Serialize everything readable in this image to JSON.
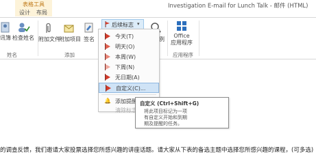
{
  "titlebar": {
    "context_group": "表格工具",
    "tabs": [
      "设计",
      "布局"
    ],
    "window_title": "Investigation E-mail for Lunch Talk - 邮件 (HTML)"
  },
  "ribbon": {
    "buttons": {
      "address_book": "讯簿",
      "check_names": "检查姓名",
      "attach_file": "附加文件",
      "attach_item": "附加项目",
      "signature": "签名",
      "zoom_partial": "比例",
      "office_apps_line1": "Office",
      "office_apps_line2": "应用程序"
    },
    "group_labels": {
      "names": "姓名",
      "include": "添加",
      "apps": "应用程序"
    },
    "flag_button": "后续标志"
  },
  "flag_menu": {
    "items": [
      "今天(T)",
      "明天(O)",
      "本周(W)",
      "下周(N)",
      "无日期(A)",
      "自定义(C)...",
      "添加提醒(",
      "清除标志("
    ]
  },
  "tooltip": {
    "title": "自定义 (Ctrl+Shift+G)",
    "lines": [
      "将此项目标记为一项",
      "有自定义开始和到期",
      "期及提醒的任务。"
    ]
  },
  "body": {
    "text": "的调查反馈，我们邀请大家投票选择您所感兴趣的讲座话题。请大家从下表的备选主题中选择您所感兴趣的课程，(可多选)"
  }
}
